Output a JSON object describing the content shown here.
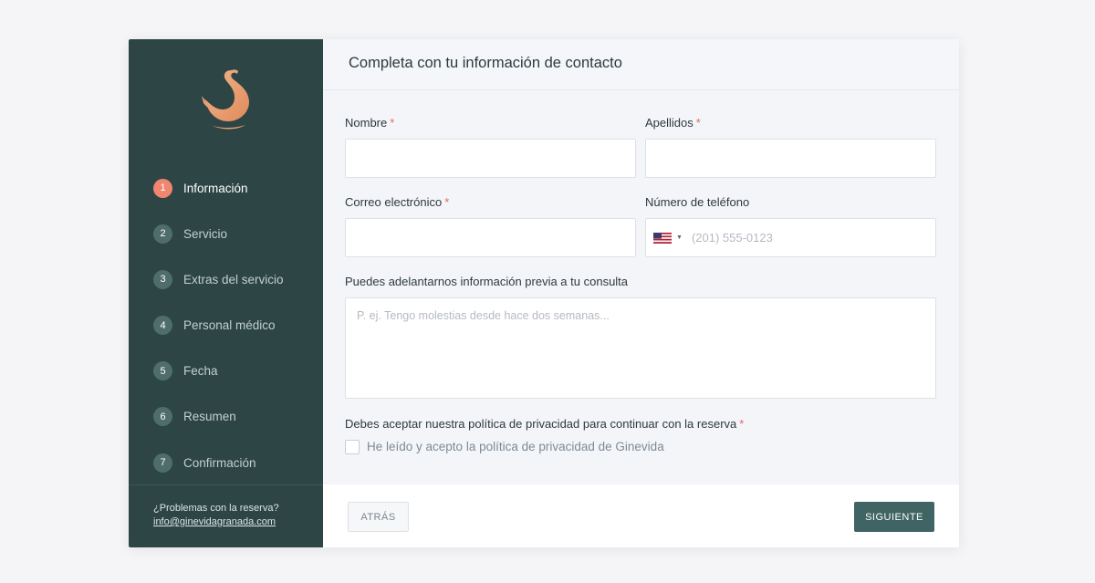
{
  "header": {
    "title": "Completa con tu información de contacto"
  },
  "sidebar": {
    "logo": "swan-logo",
    "steps": [
      {
        "num": "1",
        "label": "Información",
        "active": true
      },
      {
        "num": "2",
        "label": "Servicio"
      },
      {
        "num": "3",
        "label": "Extras del servicio"
      },
      {
        "num": "4",
        "label": "Personal médico"
      },
      {
        "num": "5",
        "label": "Fecha"
      },
      {
        "num": "6",
        "label": "Resumen"
      },
      {
        "num": "7",
        "label": "Confirmación"
      }
    ],
    "help": {
      "text": "¿Problemas con la reserva?",
      "email": "info@ginevidagranada.com"
    }
  },
  "form": {
    "nombre": {
      "label": "Nombre",
      "required": "*",
      "value": ""
    },
    "apellidos": {
      "label": "Apellidos",
      "required": "*",
      "value": ""
    },
    "email": {
      "label": "Correo electrónico",
      "required": "*",
      "value": ""
    },
    "phone": {
      "label": "Número de teléfono",
      "country": "us-flag-icon",
      "placeholder": "(201) 555-0123",
      "value": ""
    },
    "consulta": {
      "label": "Puedes adelantarnos información previa a tu consulta",
      "placeholder": "P. ej. Tengo molestias desde hace dos semanas..."
    },
    "privacy": {
      "label": "Debes aceptar nuestra política de privacidad para continuar con la reserva",
      "required": "*",
      "checkbox_label": "He leído y acepto la política de privacidad de Ginevida",
      "checked": false
    }
  },
  "footer": {
    "back_label": "ATRÁS",
    "next_label": "SIGUIENTE"
  },
  "colors": {
    "sidebar": "#2d4545",
    "accent": "#f0866f",
    "primary_button": "#3f6463",
    "required": "#e5695e"
  }
}
